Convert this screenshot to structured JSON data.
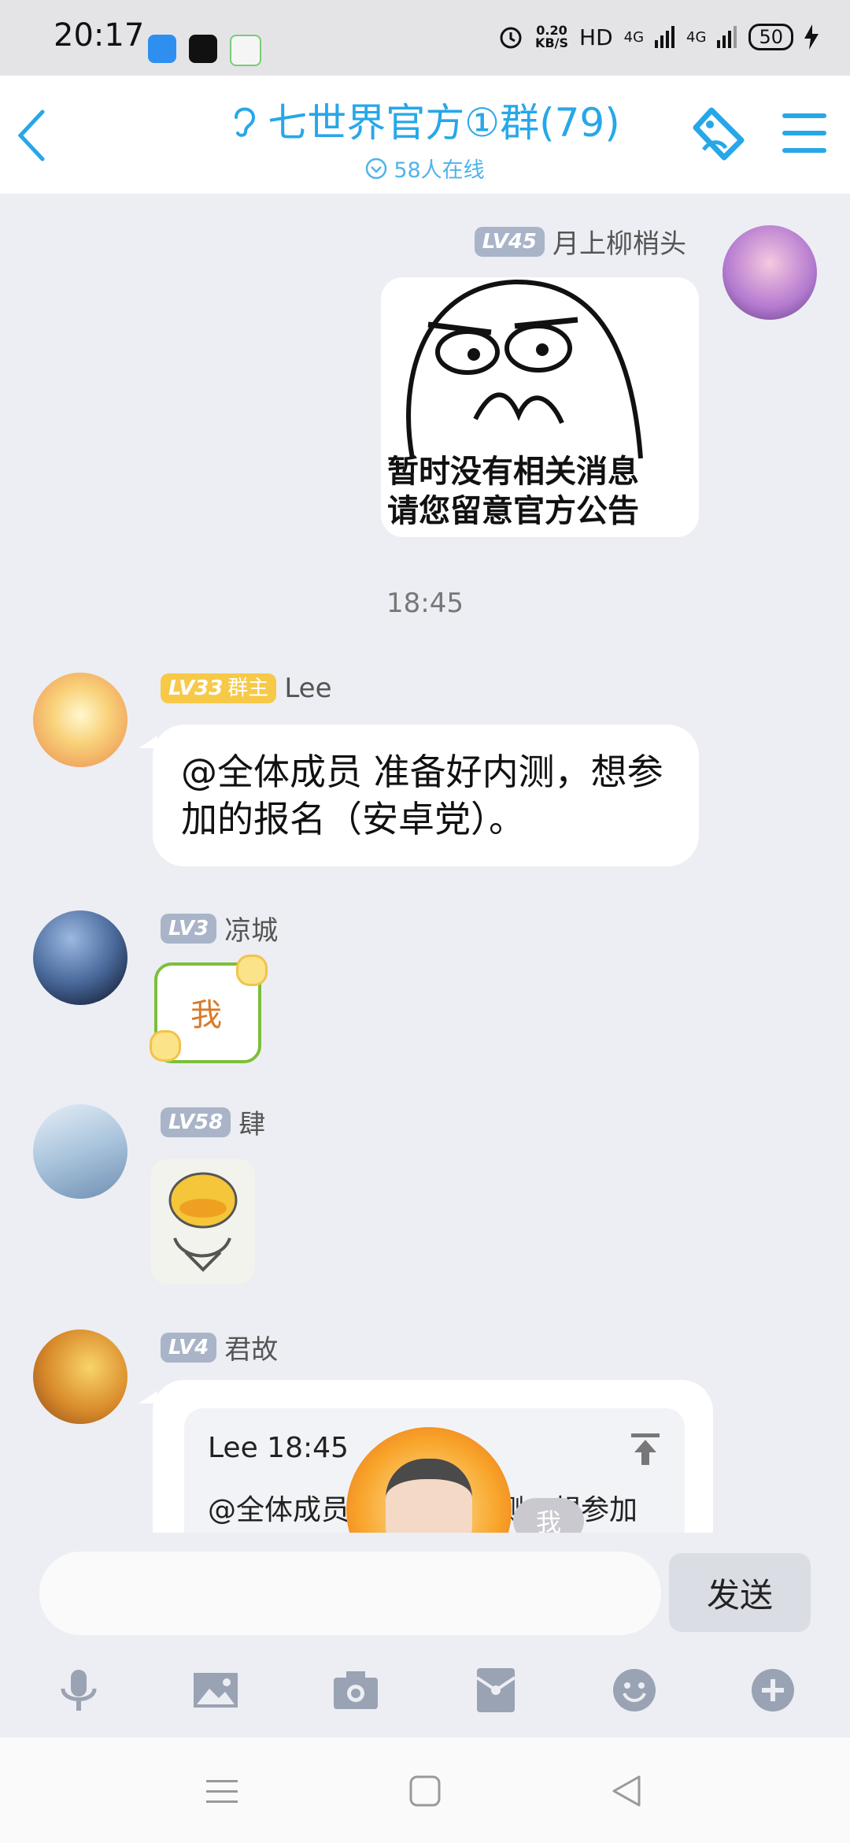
{
  "status_bar": {
    "time": "20:17",
    "net_speed_value": "0.20",
    "net_speed_unit": "KB/S",
    "hd_label": "HD",
    "signal1": "4G",
    "signal2": "4G",
    "battery": "50"
  },
  "header": {
    "title": "七世界官方①群(79)",
    "online": "58人在线"
  },
  "messages": {
    "m1": {
      "level": "LV45",
      "name": "月上柳梢头",
      "meme_line1": "暂时没有相关消息",
      "meme_line2": "请您留意官方公告"
    },
    "time_sep": "18:45",
    "m2": {
      "level": "LV33",
      "role": "群主",
      "name": "Lee",
      "text": "@全体成员 准备好内测，想参加的报名（安卓党）。"
    },
    "m3": {
      "level": "LV3",
      "name": "凉城",
      "sticker": "我"
    },
    "m4": {
      "level": "LV58",
      "name": "肆"
    },
    "m5": {
      "level": "LV4",
      "name": "君故",
      "quote_header": "Lee 18:45",
      "quote_text": "@全体成员",
      "quote_text_tail": "测，想参加",
      "tag": "我"
    }
  },
  "input": {
    "placeholder": "",
    "send_label": "发送"
  },
  "colors": {
    "accent": "#27a7e8",
    "bubble": "#ffffff",
    "background": "#eceef3"
  }
}
